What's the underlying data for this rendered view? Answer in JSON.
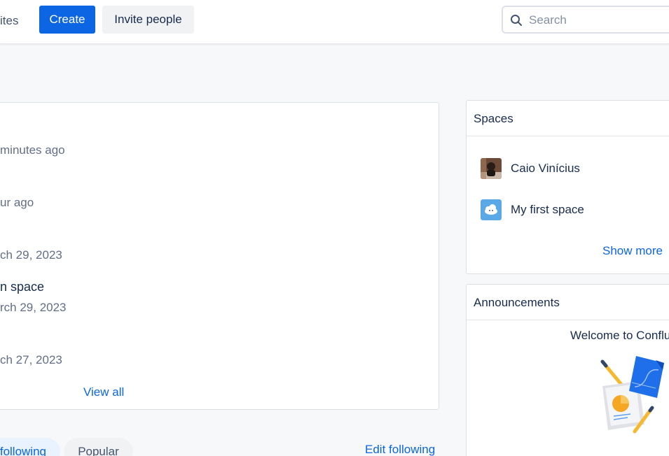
{
  "topnav": {
    "partial_item": "ites",
    "create_label": "Create",
    "invite_label": "Invite people",
    "search_placeholder": "Search"
  },
  "activity": {
    "items": [
      {
        "title": "",
        "meta": "minutes ago"
      },
      {
        "title": "",
        "meta": "ur ago"
      },
      {
        "title": "",
        "meta": "ch 29, 2023"
      },
      {
        "title": "n space",
        "meta": "rch 29, 2023"
      },
      {
        "title": "",
        "meta": "ch 27, 2023"
      }
    ],
    "view_all": "View all"
  },
  "tabs": {
    "following": "following",
    "popular": "Popular",
    "edit_following": "Edit following"
  },
  "spaces": {
    "title": "Spaces",
    "items": [
      {
        "name": "Caio Vinícius",
        "icon": "user-photo-avatar"
      },
      {
        "name": "My first space",
        "icon": "cloud-space-icon"
      }
    ],
    "show_more": "Show more"
  },
  "announcements": {
    "title": "Announcements",
    "welcome": "Welcome to Conflu",
    "illustration": "documents-chart-pencils-illustration"
  },
  "colors": {
    "primary": "#0c66e4",
    "text": "#172b4d",
    "subtle": "#626f86",
    "background": "#f7f8f9"
  }
}
